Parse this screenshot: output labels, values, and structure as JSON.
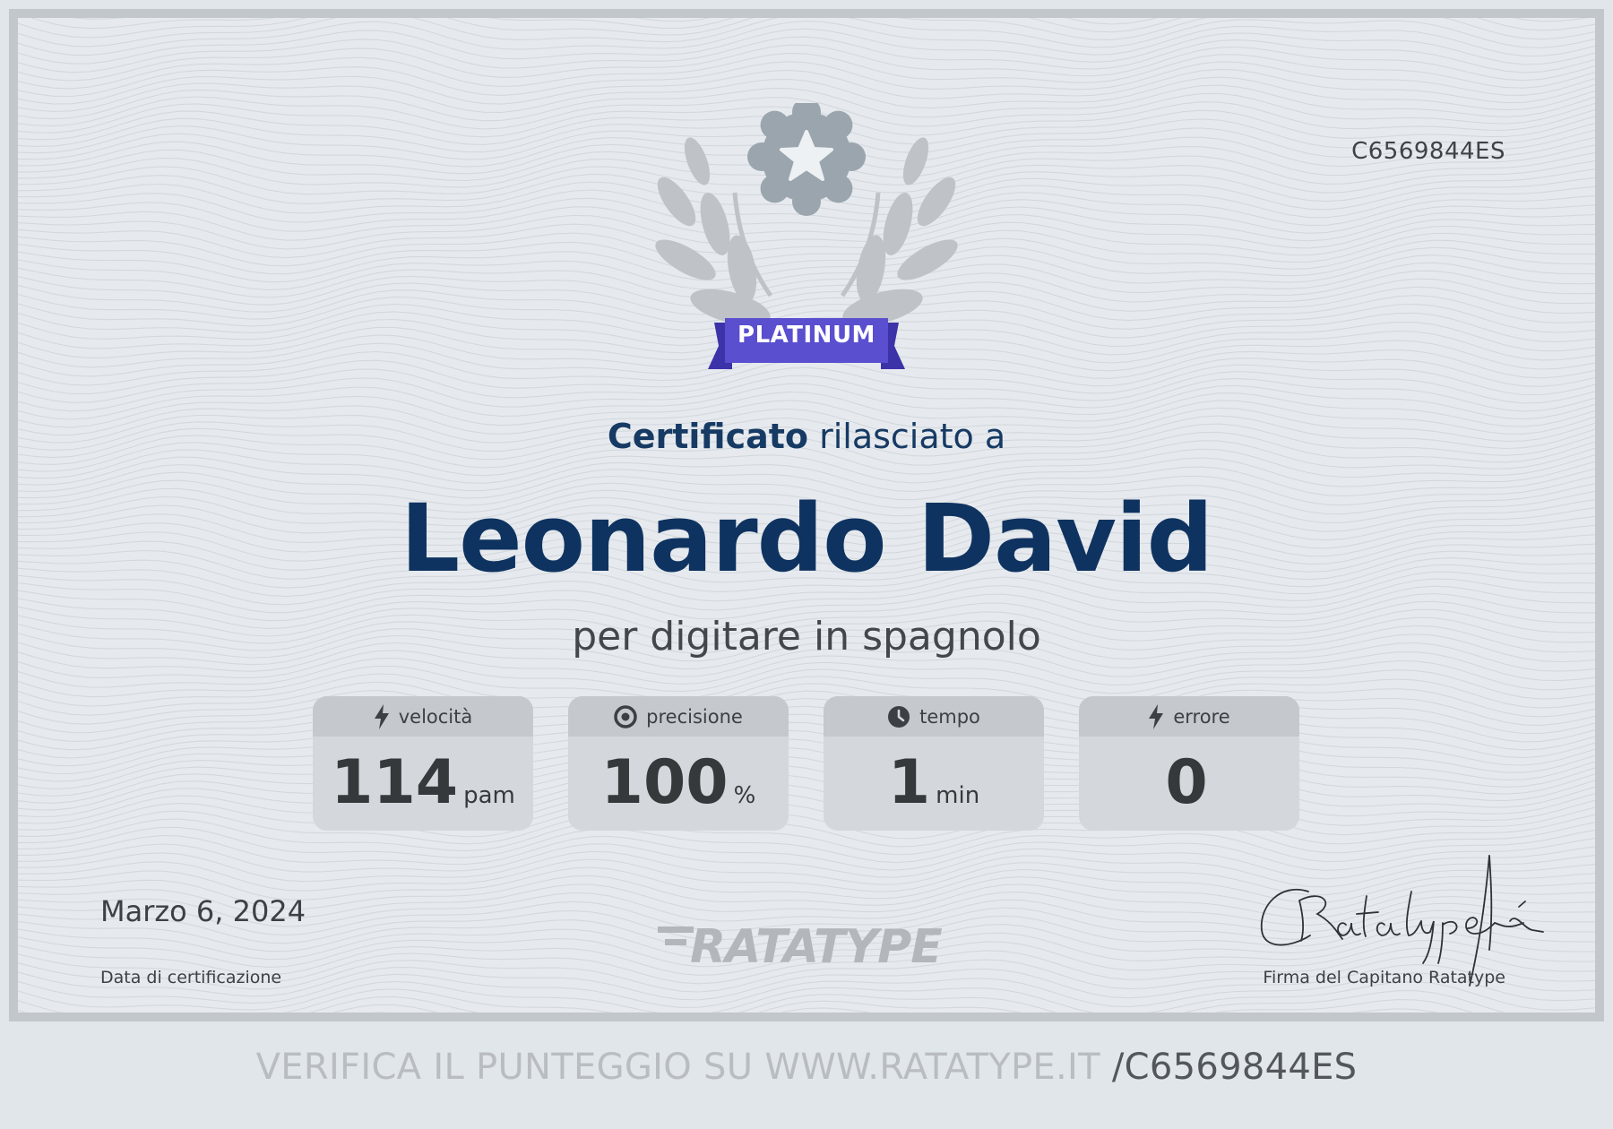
{
  "certificate": {
    "id": "C6569844ES",
    "badge": "PLATINUM",
    "issued_strong": "Certificato",
    "issued_rest": " rilasciato a",
    "recipient": "Leonardo David",
    "subject": "per digitare in spagnolo",
    "date": "Marzo 6, 2024",
    "date_label": "Data di certificazione",
    "brand": "RATATYPE",
    "signature_label": "Firma del Capitano Ratatype"
  },
  "stats": [
    {
      "icon": "lightning-icon",
      "label": "velocità",
      "value": "114",
      "unit": "pam"
    },
    {
      "icon": "target-icon",
      "label": "precisione",
      "value": "100",
      "unit": "%"
    },
    {
      "icon": "clock-icon",
      "label": "tempo",
      "value": "1",
      "unit": "min"
    },
    {
      "icon": "lightning-icon",
      "label": "errore",
      "value": "0",
      "unit": ""
    }
  ],
  "footer": {
    "verify_text": "VERIFICA IL PUNTEGGIO SU WWW.RATATYPE.IT ",
    "verify_code": "/C6569844ES"
  },
  "colors": {
    "badge_ribbon": "#5a4fcf",
    "title_navy": "#0f3360",
    "emblem_gray": "#9aa5ae"
  }
}
